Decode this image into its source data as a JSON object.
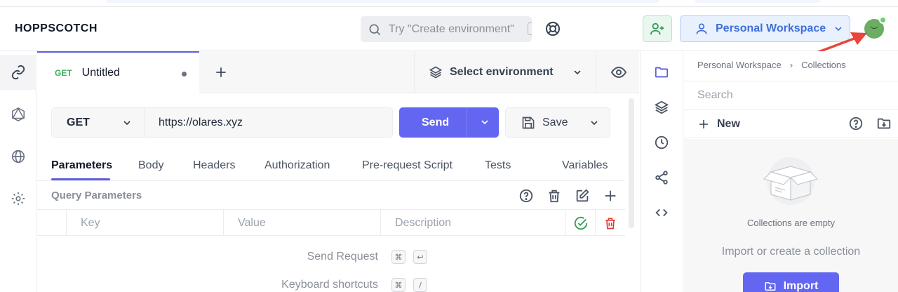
{
  "app": {
    "brand": "HOPPSCOTCH"
  },
  "header": {
    "search_placeholder": "Try \"Create environment\"",
    "workspace_label": "Personal Workspace"
  },
  "tab": {
    "method": "GET",
    "name": "Untitled"
  },
  "environment": {
    "label": "Select environment"
  },
  "request": {
    "method": "GET",
    "url": "https://olares.xyz",
    "send_label": "Send",
    "save_label": "Save"
  },
  "subtabs": [
    "Parameters",
    "Body",
    "Headers",
    "Authorization",
    "Pre-request Script",
    "Tests",
    "Variables"
  ],
  "query": {
    "label": "Query Parameters",
    "columns": {
      "key": "Key",
      "value": "Value",
      "description": "Description"
    }
  },
  "shortcuts": [
    {
      "label": "Send Request",
      "keys": [
        "⌘",
        "↩"
      ]
    },
    {
      "label": "Keyboard shortcuts",
      "keys": [
        "⌘",
        "/"
      ]
    }
  ],
  "collections": {
    "breadcrumb": [
      "Personal Workspace",
      "Collections"
    ],
    "search_placeholder": "Search",
    "new_label": "New",
    "empty_title": "Collections are empty",
    "empty_subtitle": "Import or create a collection",
    "import_label": "Import"
  },
  "colors": {
    "accent": "#6366f1",
    "method_green": "#3fb05c",
    "workspace_blue": "#3f6fd8",
    "delete_red": "#e53935",
    "annotation_arrow": "#e8453c"
  }
}
